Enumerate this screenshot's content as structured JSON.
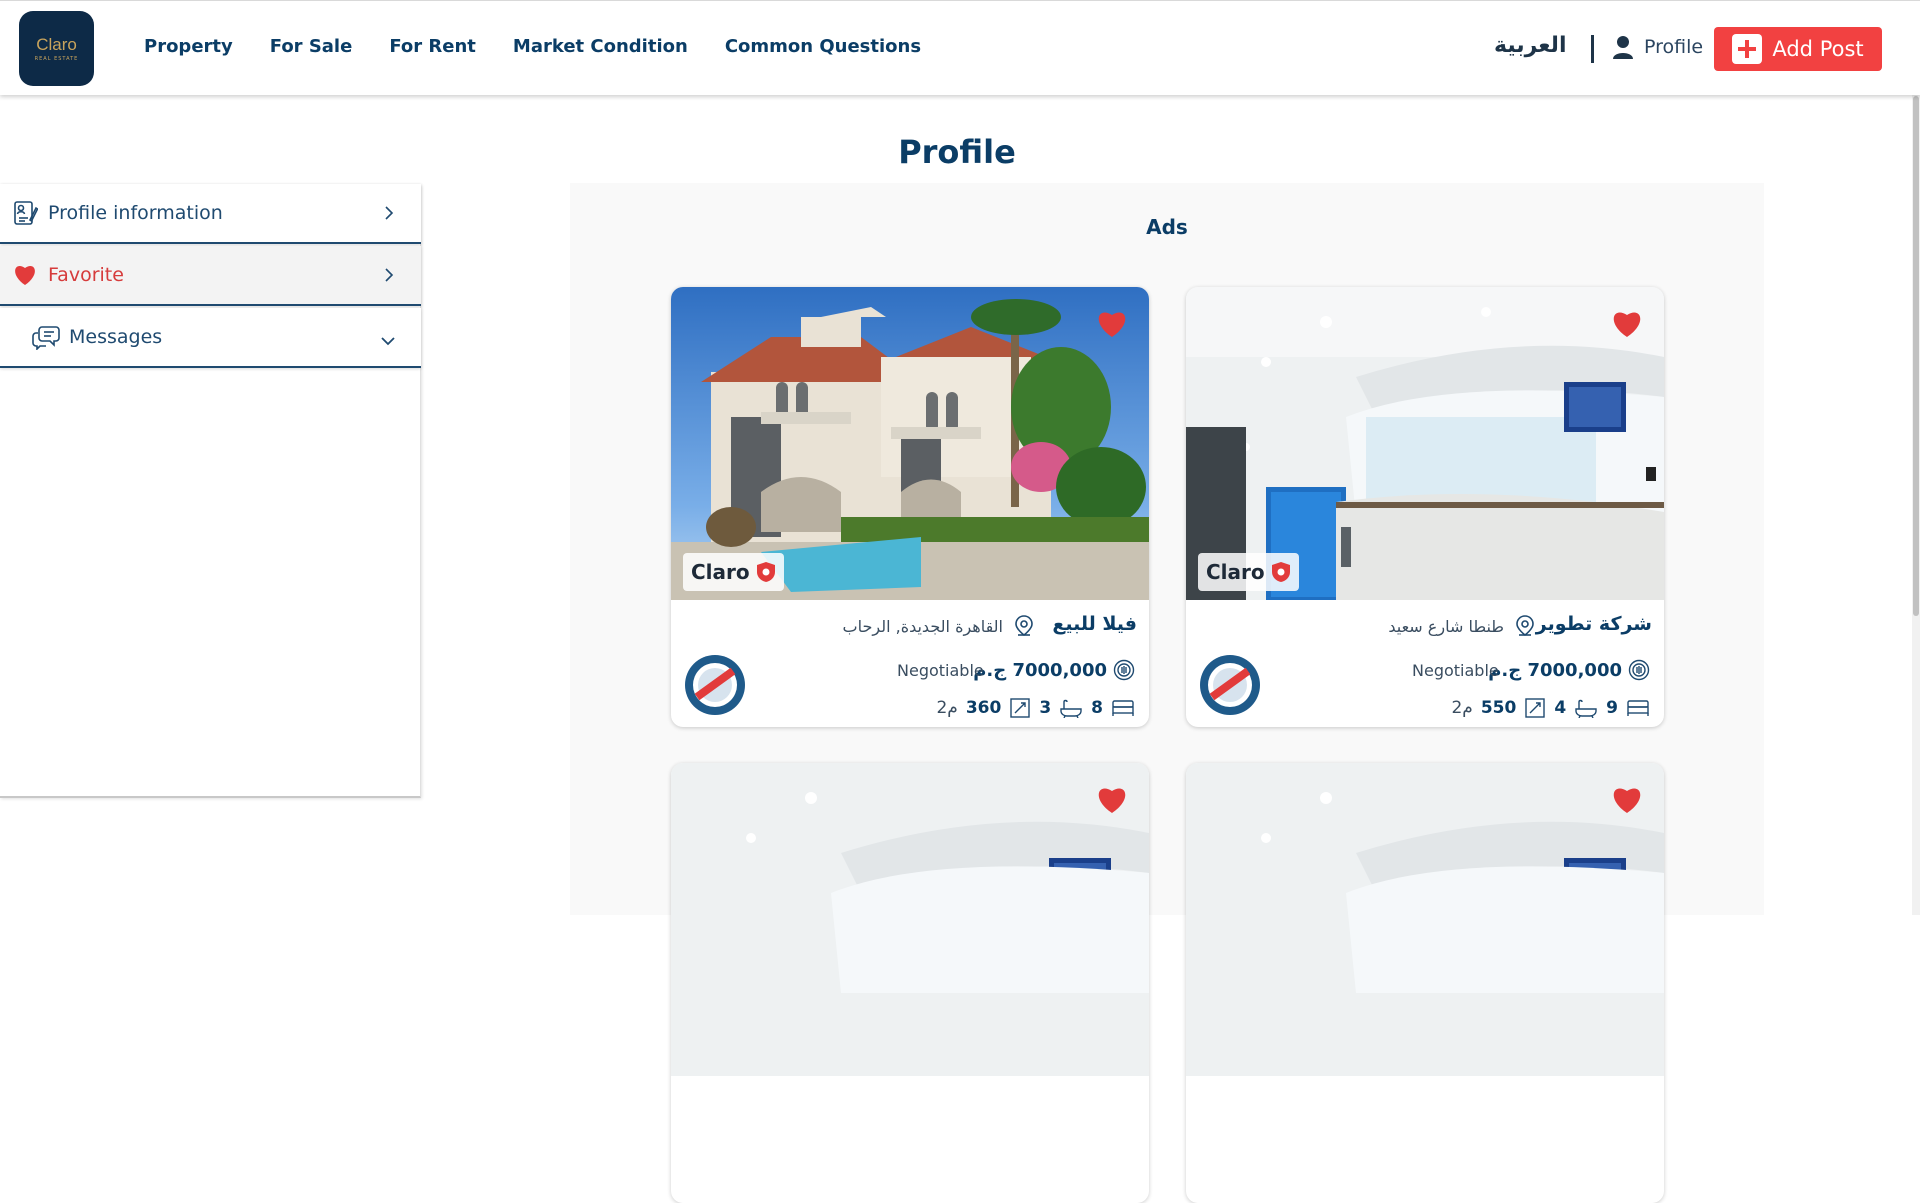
{
  "header": {
    "logo_text": "Claro",
    "logo_subtext": "REAL ESTATE",
    "nav": [
      "Property",
      "For Sale",
      "For Rent",
      "Market Condition",
      "Common Questions"
    ],
    "language_label": "العربية",
    "profile_label": "Profile",
    "add_post_label": "Add Post"
  },
  "sidebar": {
    "items": [
      {
        "label": "Profile information",
        "icon": "profile-document-icon",
        "chevron": "chevron-right-icon"
      },
      {
        "label": "Favorite",
        "icon": "heart-icon",
        "chevron": "chevron-right-icon"
      },
      {
        "label": "Messages",
        "icon": "chat-bubbles-icon",
        "chevron": "chevron-down-icon"
      }
    ]
  },
  "main": {
    "title": "Profile",
    "section_title": "Ads"
  },
  "cards": [
    {
      "title": "فيلا للبيع",
      "location": "القاهرة الجديدة, الرحاب",
      "price": "7000,000 ج.م",
      "negotiable": "Negotiable",
      "beds": "8",
      "baths": "3",
      "area": "360",
      "area_unit": "م2",
      "brand": "Claro",
      "photo": "villa-photo"
    },
    {
      "title": "شركة تطوير",
      "location": "طنطا شارع سعيد",
      "price": "7000,000 ج.م",
      "negotiable": "Negotiable",
      "beds": "9",
      "baths": "4",
      "area": "550",
      "area_unit": "م2",
      "brand": "Claro",
      "photo": "office-reception-photo"
    },
    {
      "photo": "office-reception-photo"
    },
    {
      "photo": "office-reception-photo"
    }
  ],
  "colors": {
    "brand_navy": "#0b3d66",
    "accent_red": "#f24141",
    "heart_red": "#e23b3b"
  }
}
